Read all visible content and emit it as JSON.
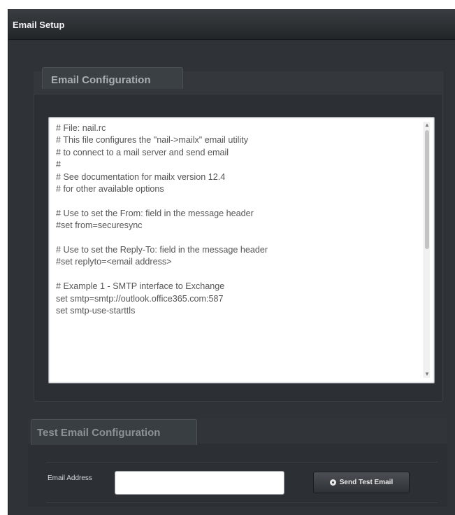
{
  "window": {
    "title": "Email Setup"
  },
  "email_configuration": {
    "legend": "Email Configuration",
    "lines": [
      "# File: nail.rc",
      "# This file configures the \"nail->mailx\" email utility",
      "# to connect to a mail server and send email",
      "#",
      "# See documentation for mailx version 12.4",
      "# for other available options",
      "",
      "# Use to set the From: field in the message header",
      "#set from=securesync",
      "",
      "# Use to set the Reply-To: field in the message header",
      "#set replyto=<email address>",
      "",
      "# Example 1 - SMTP interface to Exchange",
      "set smtp=smtp://outlook.office365.com:587",
      "set smtp-use-starttls"
    ]
  },
  "test_email": {
    "legend": "Test Email Configuration",
    "address_label": "Email Address",
    "address_value": "",
    "send_button": "Send Test Email"
  },
  "icons": {
    "send_button_icon": "gear-icon"
  },
  "colors": {
    "background": "#2f3337",
    "panel": "#2c3034",
    "text_box": "#ffffff"
  }
}
